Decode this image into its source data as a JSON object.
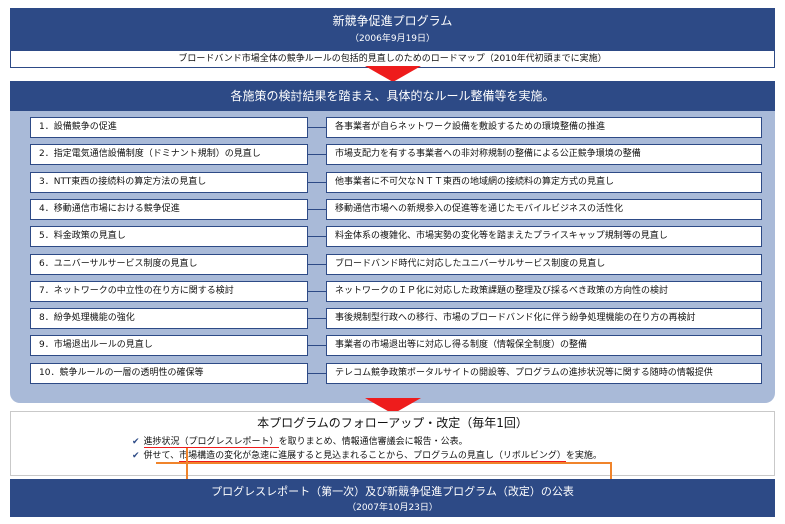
{
  "title": {
    "main": "新競争促進プログラム",
    "date": "（2006年9月19日）"
  },
  "roadmap": "ブロードバンド市場全体の競争ルールの包括的見直しのためのロードマップ（2010年代初頭までに実施）",
  "banner2": "各施策の検討結果を踏まえ、具体的なルール整備等を実施。",
  "measures": [
    {
      "left": "1．設備競争の促進",
      "right": "各事業者が自らネットワーク設備を敷設するための環境整備の推進"
    },
    {
      "left": "2．指定電気通信設備制度（ドミナント規制）の見直し",
      "right": "市場支配力を有する事業者への非対称規制の整備による公正競争環境の整備"
    },
    {
      "left": "3．NTT東西の接続料の算定方法の見直し",
      "right": "他事業者に不可欠なＮＴＴ東西の地域網の接続料の算定方式の見直し"
    },
    {
      "left": "4．移動通信市場における競争促進",
      "right": "移動通信市場への新規参入の促進等を通じたモバイルビジネスの活性化"
    },
    {
      "left": "5．料金政策の見直し",
      "right": "料金体系の複雑化、市場実勢の変化等を踏まえたプライスキャップ規制等の見直し"
    },
    {
      "left": "6．ユニバーサルサービス制度の見直し",
      "right": "ブロードバンド時代に対応したユニバーサルサービス制度の見直し"
    },
    {
      "left": "7．ネットワークの中立性の在り方に関する検討",
      "right": "ネットワークのＩＰ化に対応した政策課題の整理及び採るべき政策の方向性の検討"
    },
    {
      "left": "8．紛争処理機能の強化",
      "right": "事後規制型行政への移行、市場のブロードバンド化に伴う紛争処理機能の在り方の再検討"
    },
    {
      "left": "9．市場退出ルールの見直し",
      "right": "事業者の市場退出等に対応し得る制度（情報保全制度）の整備"
    },
    {
      "left": "10．競争ルールの一層の透明性の確保等",
      "right": "テレコム競争政策ポータルサイトの開設等、プログラムの進捗状況等に関する随時の情報提供"
    }
  ],
  "followup": {
    "title": "本プログラムのフォローアップ・改定（毎年1回）",
    "line1_a": "進捗状況（プログレスレポート）",
    "line1_b": "を取りまとめ、情報通信審議会に報告・公表。",
    "line2_a": "併せて、",
    "line2_b": "市場構造の変化が急速に進展すると見込まれることから、",
    "line2_c": "プログラムの見直し（リボルビング）",
    "line2_d": "を実施。"
  },
  "final": {
    "main": "プログレスレポート（第一次）及び新競争促進プログラム（改定）の公表",
    "date": "（2007年10月23日）"
  },
  "colors": {
    "navy": "#2d4a86",
    "panel": "#a9bad8",
    "arrow": "#ee1c1c",
    "connector": "#f0842b"
  }
}
